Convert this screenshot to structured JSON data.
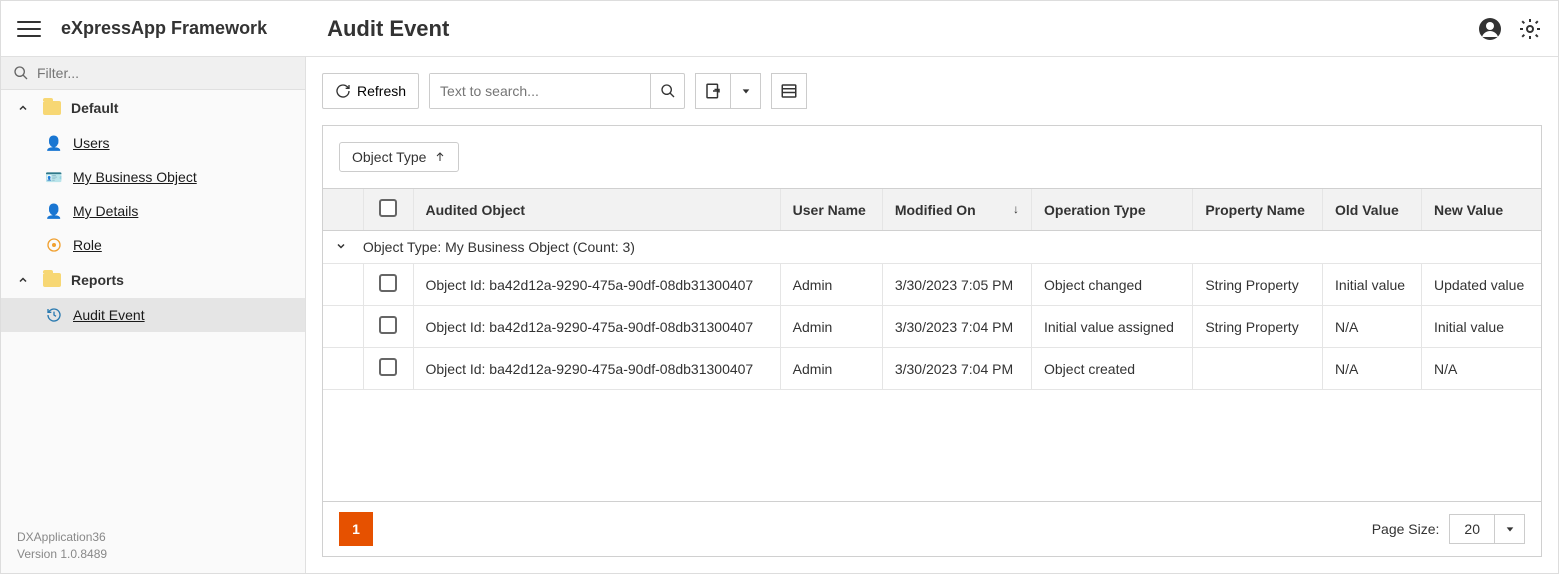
{
  "header": {
    "app_title": "eXpressApp Framework",
    "page_title": "Audit Event"
  },
  "sidebar": {
    "filter_placeholder": "Filter...",
    "groups": [
      {
        "label": "Default",
        "items": [
          {
            "label": "Users"
          },
          {
            "label": "My Business Object"
          },
          {
            "label": "My Details"
          },
          {
            "label": "Role"
          }
        ]
      },
      {
        "label": "Reports",
        "items": [
          {
            "label": "Audit Event"
          }
        ]
      }
    ],
    "footer_app": "DXApplication36",
    "footer_version": "Version 1.0.8489"
  },
  "toolbar": {
    "refresh_label": "Refresh",
    "search_placeholder": "Text to search..."
  },
  "grid": {
    "group_chip": "Object Type",
    "columns": {
      "audited_object": "Audited Object",
      "user_name": "User Name",
      "modified_on": "Modified On",
      "operation_type": "Operation Type",
      "property_name": "Property Name",
      "old_value": "Old Value",
      "new_value": "New Value"
    },
    "group_row": "Object Type: My Business Object (Count: 3)",
    "rows": [
      {
        "audited_object": "Object Id: ba42d12a-9290-475a-90df-08db31300407",
        "user_name": "Admin",
        "modified_on": "3/30/2023 7:05 PM",
        "operation_type": "Object changed",
        "property_name": "String Property",
        "old_value": "Initial value",
        "new_value": "Updated value"
      },
      {
        "audited_object": "Object Id: ba42d12a-9290-475a-90df-08db31300407",
        "user_name": "Admin",
        "modified_on": "3/30/2023 7:04 PM",
        "operation_type": "Initial value assigned",
        "property_name": "String Property",
        "old_value": "N/A",
        "new_value": "Initial value"
      },
      {
        "audited_object": "Object Id: ba42d12a-9290-475a-90df-08db31300407",
        "user_name": "Admin",
        "modified_on": "3/30/2023 7:04 PM",
        "operation_type": "Object created",
        "property_name": "",
        "old_value": "N/A",
        "new_value": "N/A"
      }
    ]
  },
  "pager": {
    "current_page": "1",
    "page_size_label": "Page Size:",
    "page_size_value": "20"
  }
}
